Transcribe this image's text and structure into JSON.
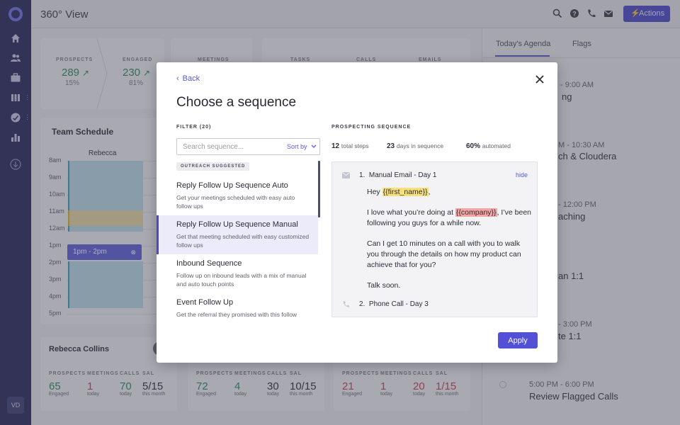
{
  "app": {
    "title": "360° View",
    "user_initials": "VD",
    "actions_label": "Actions"
  },
  "sidebar": {
    "icons": [
      "logo-icon",
      "home-icon",
      "people-icon",
      "briefcase-icon",
      "reports-icon",
      "chart-check-icon",
      "bar-chart-icon",
      "download-icon"
    ]
  },
  "topbar": {
    "icons": [
      "search-icon",
      "help-icon",
      "phone-icon",
      "mail-icon"
    ]
  },
  "stats_card_1": {
    "prospects_label": "PROSPECTS",
    "prospects_value": "289",
    "prospects_pct": "15%",
    "engaged_label": "ENGAGED",
    "engaged_value": "230",
    "engaged_pct": "81%"
  },
  "stats_card_2": {
    "meetings_label": "MEETINGS"
  },
  "stats_card_3": {
    "tasks_label": "TASKS",
    "calls_label": "CALLS",
    "emails_label": "EMAILS"
  },
  "team_schedule": {
    "title": "Team Schedule",
    "person": "Rebecca",
    "hours": [
      "8am",
      "9am",
      "10am",
      "11am",
      "12am",
      "1pm",
      "2pm",
      "3pm",
      "4pm",
      "5pm"
    ],
    "event_label": "1pm - 2pm"
  },
  "bottom_cards": [
    {
      "name": "Rebecca Collins",
      "stats": [
        {
          "label": "PROSPECTS",
          "value": "65",
          "sub": "Engaged",
          "color": "#2e8b57"
        },
        {
          "label": "MEETINGS",
          "value": "1",
          "sub": "today",
          "color": "#c9404a"
        },
        {
          "label": "CALLS",
          "value": "70",
          "sub": "today",
          "color": "#2e8b57"
        },
        {
          "label": "SAL",
          "value": "5/15",
          "sub": "this month",
          "color": "#2b2e39"
        }
      ]
    },
    {
      "name": "",
      "stats": [
        {
          "label": "PROSPECTS",
          "value": "72",
          "sub": "Engaged",
          "color": "#2e8b57"
        },
        {
          "label": "MEETINGS",
          "value": "4",
          "sub": "today",
          "color": "#2e8b57"
        },
        {
          "label": "CALLS",
          "value": "30",
          "sub": "today",
          "color": "#2b2e39"
        },
        {
          "label": "SAL",
          "value": "10/15",
          "sub": "this month",
          "color": "#2b2e39"
        }
      ]
    },
    {
      "name": "",
      "stats": [
        {
          "label": "PROSPECTS",
          "value": "21",
          "sub": "Engaged",
          "color": "#c9404a"
        },
        {
          "label": "MEETINGS",
          "value": "1",
          "sub": "today",
          "color": "#c9404a"
        },
        {
          "label": "CALLS",
          "value": "20",
          "sub": "today",
          "color": "#c9404a"
        },
        {
          "label": "SAL",
          "value": "1/15",
          "sub": "this month",
          "color": "#c9404a"
        }
      ]
    }
  ],
  "right_panel": {
    "tabs": [
      "Today's Agenda",
      "Flags"
    ],
    "agenda": [
      {
        "time": "- 9:00 AM",
        "title": "ng"
      },
      {
        "time": "M - 10:30 AM",
        "title": "ch & Cloudera"
      },
      {
        "time": "- 12:00 PM",
        "title": "aching"
      },
      {
        "time": "",
        "title": "an 1:1"
      },
      {
        "time": "- 3:00 PM",
        "title": "te 1:1"
      },
      {
        "time": "5:00 PM - 6:00 PM",
        "title": "Review Flagged Calls"
      }
    ]
  },
  "modal": {
    "back_label": "Back",
    "title": "Choose a sequence",
    "filter_label": "FILTER (20)",
    "search_placeholder": "Search sequence...",
    "sort_label": "Sort by",
    "suggested_badge": "OUTREACH SUGGESTED",
    "sequences": [
      {
        "name": "Reply Follow Up Sequence Auto",
        "desc": "Get your meetings scheduled with easy auto follow ups"
      },
      {
        "name": "Reply Follow Up Sequence Manual",
        "desc": "Get that meeting scheduled with easy customized follow ups"
      },
      {
        "name": "Inbound Sequence",
        "desc": "Follow up on inbound leads with a mix of manual and auto touch points"
      },
      {
        "name": "Event Follow Up",
        "desc": "Get the referral they promised with this follow"
      }
    ],
    "selected_index": 1,
    "prospecting_label": "PROSPECTING SEQUENCE",
    "stats": [
      {
        "value": "12",
        "label": "total steps"
      },
      {
        "value": "23",
        "label": "days in sequence"
      },
      {
        "value": "60%",
        "label": "automated"
      }
    ],
    "steps": [
      {
        "number": "1.",
        "title": "Manual Email - Day 1",
        "type_icon": "mail-icon"
      },
      {
        "number": "2.",
        "title": "Phone Call - Day 3",
        "type_icon": "phone-icon"
      }
    ],
    "hide_label": "hide",
    "email": {
      "greeting": "Hey",
      "first_name_token": "{{first_name}}",
      "greeting_end": ",",
      "line1_pre": "I love what you’re doing at",
      "company_token": "{{company}}",
      "line1_post": ", I’ve been following you guys for a while now.",
      "line2": "Can I get 10 minutes on a call with you to walk you through the details on how my product can achieve that for you?",
      "signoff": "Talk soon."
    },
    "apply_label": "Apply"
  },
  "colors": {
    "sidebar_bg": "#26275a",
    "accent": "#5250d6",
    "positive": "#2e8b57",
    "negative": "#c9404a",
    "first_name_highlight": "#f7e07a",
    "company_highlight": "#f3a7a4"
  }
}
